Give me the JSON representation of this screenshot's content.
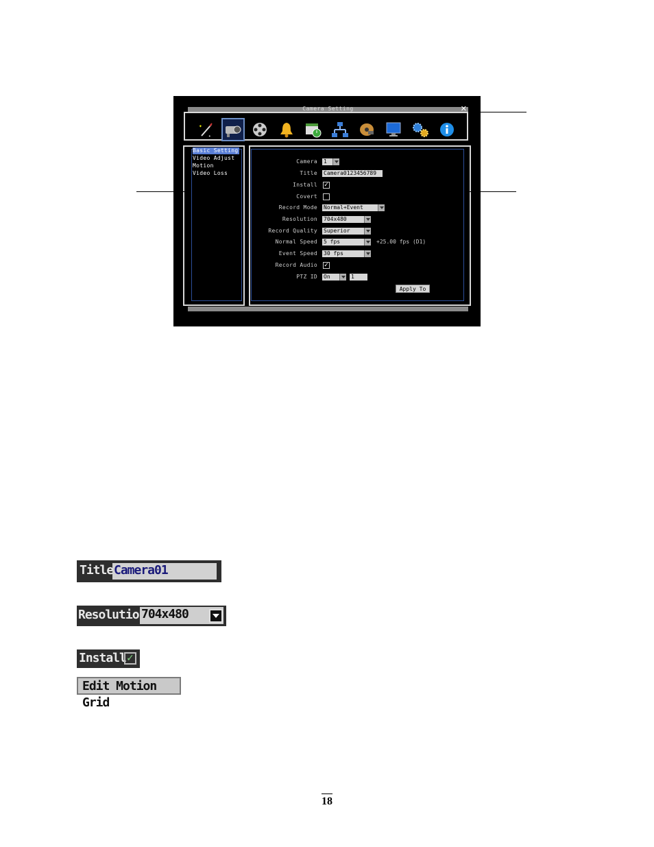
{
  "window": {
    "title": "Camera Setting",
    "close_glyph": "✕"
  },
  "toolbar": {
    "icons": [
      "wizard-icon",
      "camera-icon",
      "film-reel-icon",
      "bell-icon",
      "calendar-clock-icon",
      "network-icon",
      "disk-icon",
      "monitor-icon",
      "gears-icon",
      "info-icon"
    ],
    "selected": "camera-icon"
  },
  "menu": {
    "items": [
      "Basic Setting",
      "Video Adjust",
      "Motion",
      "Video Loss"
    ],
    "selected": "Basic Setting"
  },
  "form": {
    "camera": {
      "label": "Camera",
      "value": "1"
    },
    "title": {
      "label": "Title",
      "value": "Camera0123456789"
    },
    "install": {
      "label": "Install",
      "checked": true
    },
    "covert": {
      "label": "Covert",
      "checked": false
    },
    "record_mode": {
      "label": "Record Mode",
      "value": "Normal+Event"
    },
    "resolution": {
      "label": "Resolution",
      "value": "704x480"
    },
    "record_quality": {
      "label": "Record Quality",
      "value": "Superior"
    },
    "normal_speed": {
      "label": "Normal Speed",
      "value": "5 fps"
    },
    "fps_note": "+25.00 fps (D1)",
    "event_speed": {
      "label": "Event Speed",
      "value": "30 fps"
    },
    "record_audio": {
      "label": "Record Audio",
      "checked": true
    },
    "ptz_id": {
      "label": "PTZ ID",
      "value": "On",
      "id_value": "1"
    },
    "apply_label": "Apply To"
  },
  "examples": {
    "title": {
      "label": "Title",
      "value": "Camera01"
    },
    "resolution": {
      "label": "Resolution",
      "value": "704x480"
    },
    "install": {
      "label": "Install"
    },
    "edit_motion_grid": {
      "label": "Edit Motion Grid"
    }
  },
  "page_number": "18"
}
